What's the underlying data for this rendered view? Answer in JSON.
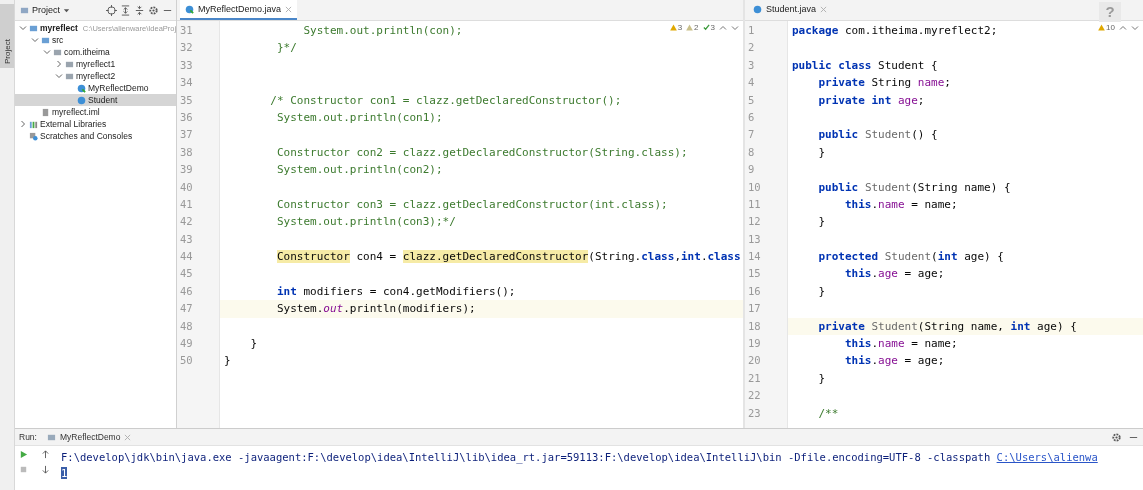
{
  "side_strip": {
    "label": "Project"
  },
  "project": {
    "title": "Project",
    "tree": [
      {
        "label": "myreflect",
        "path": "C:\\Users\\alienware\\IdeaProj",
        "kind": "module",
        "expanded": true,
        "selected": false,
        "children": [
          {
            "label": "src",
            "kind": "src",
            "expanded": true,
            "selected": false,
            "children": [
              {
                "label": "com.itheima",
                "kind": "package",
                "expanded": true,
                "selected": false,
                "children": [
                  {
                    "label": "myreflect1",
                    "kind": "package",
                    "expanded": false,
                    "selected": false
                  },
                  {
                    "label": "myreflect2",
                    "kind": "package",
                    "expanded": true,
                    "selected": false,
                    "children": [
                      {
                        "label": "MyReflectDemo",
                        "kind": "main-class",
                        "selected": false
                      },
                      {
                        "label": "Student",
                        "kind": "class",
                        "selected": true
                      }
                    ]
                  }
                ]
              }
            ]
          },
          {
            "label": "myreflect.iml",
            "kind": "iml",
            "selected": false
          }
        ]
      },
      {
        "label": "External Libraries",
        "kind": "libs",
        "expanded": false,
        "selected": false
      },
      {
        "label": "Scratches and Consoles",
        "kind": "scratch",
        "selected": false
      }
    ]
  },
  "editors": [
    {
      "tab": "MyReflectDemo.java",
      "kind": "main-class",
      "active": true,
      "inspections": [
        {
          "kind": "warning",
          "count": "3"
        },
        {
          "kind": "weak",
          "count": "2"
        },
        {
          "kind": "ok",
          "count": "3"
        }
      ],
      "lines": [
        {
          "num": "31",
          "current": false,
          "tokens": [
            {
              "kind": "comment",
              "text": "            System.out.println(con);"
            }
          ]
        },
        {
          "num": "32",
          "current": false,
          "tokens": [
            {
              "kind": "comment",
              "text": "        }*/"
            }
          ]
        },
        {
          "num": "33",
          "current": false
        },
        {
          "num": "34",
          "current": false
        },
        {
          "num": "35",
          "current": false,
          "tokens": [
            {
              "kind": "comment",
              "text": "       /* Constructor con1 = clazz.getDeclaredConstructor();"
            }
          ]
        },
        {
          "num": "36",
          "current": false,
          "tokens": [
            {
              "kind": "comment",
              "text": "        System.out.println(con1);"
            }
          ]
        },
        {
          "num": "37",
          "current": false
        },
        {
          "num": "38",
          "current": false,
          "tokens": [
            {
              "kind": "comment",
              "text": "        Constructor con2 = clazz.getDeclaredConstructor(String.class);"
            }
          ]
        },
        {
          "num": "39",
          "current": false,
          "tokens": [
            {
              "kind": "comment",
              "text": "        System.out.println(con2);"
            }
          ]
        },
        {
          "num": "40",
          "current": false
        },
        {
          "num": "41",
          "current": false,
          "tokens": [
            {
              "kind": "comment",
              "text": "        Constructor con3 = clazz.getDeclaredConstructor(int.class);"
            }
          ]
        },
        {
          "num": "42",
          "current": false,
          "tokens": [
            {
              "kind": "comment",
              "text": "        System.out.println(con3);*/"
            }
          ]
        },
        {
          "num": "43",
          "current": false
        },
        {
          "num": "44",
          "current": false,
          "tokens": [
            {
              "kind": "highlight",
              "text": "        Constructor"
            },
            {
              "kind": "plain",
              "text": " con4 = "
            },
            {
              "kind": "highlight",
              "text": "clazz.getDeclaredConstructor"
            },
            {
              "kind": "plain",
              "text": "(String."
            },
            {
              "kind": "keyword",
              "text": "class"
            },
            {
              "kind": "plain",
              "text": ","
            },
            {
              "kind": "keyword",
              "text": "int"
            },
            {
              "kind": "plain",
              "text": "."
            },
            {
              "kind": "keyword",
              "text": "class"
            }
          ]
        },
        {
          "num": "45",
          "current": false
        },
        {
          "num": "46",
          "current": false,
          "tokens": [
            {
              "kind": "keyword",
              "text": "        int"
            },
            {
              "kind": "plain",
              "text": " modifiers = con4.getModifiers();"
            }
          ]
        },
        {
          "num": "47",
          "current": true,
          "tokens": [
            {
              "kind": "plain",
              "text": "        System."
            },
            {
              "kind": "static",
              "text": "out"
            },
            {
              "kind": "plain",
              "text": ".println(modifiers);"
            }
          ]
        },
        {
          "num": "48",
          "current": false
        },
        {
          "num": "49",
          "current": false,
          "tokens": [
            {
              "kind": "plain",
              "text": "    }"
            }
          ]
        },
        {
          "num": "50",
          "current": false,
          "tokens": [
            {
              "kind": "plain",
              "text": "}"
            }
          ]
        }
      ]
    },
    {
      "tab": "Student.java",
      "kind": "class",
      "active": false,
      "inspections": [
        {
          "kind": "warning",
          "count": "10"
        }
      ],
      "lines": [
        {
          "num": "1",
          "current": false,
          "tokens": [
            {
              "kind": "keyword",
              "text": "package"
            },
            {
              "kind": "plain",
              "text": " com.itheima.myreflect2;"
            }
          ]
        },
        {
          "num": "2",
          "current": false
        },
        {
          "num": "3",
          "current": false,
          "tokens": [
            {
              "kind": "keyword",
              "text": "public class"
            },
            {
              "kind": "plain",
              "text": " Student {"
            }
          ]
        },
        {
          "num": "4",
          "current": false,
          "tokens": [
            {
              "kind": "keyword",
              "text": "    private"
            },
            {
              "kind": "plain",
              "text": " String "
            },
            {
              "kind": "field",
              "text": "name"
            },
            {
              "kind": "plain",
              "text": ";"
            }
          ]
        },
        {
          "num": "5",
          "current": false,
          "tokens": [
            {
              "kind": "keyword",
              "text": "    private int"
            },
            {
              "kind": "field",
              "text": " age"
            },
            {
              "kind": "plain",
              "text": ";"
            }
          ]
        },
        {
          "num": "6",
          "current": false
        },
        {
          "num": "7",
          "current": false,
          "tokens": [
            {
              "kind": "keyword",
              "text": "    public"
            },
            {
              "kind": "unused",
              "text": " Student"
            },
            {
              "kind": "plain",
              "text": "() {"
            }
          ]
        },
        {
          "num": "8",
          "current": false,
          "tokens": [
            {
              "kind": "plain",
              "text": "    }"
            }
          ]
        },
        {
          "num": "9",
          "current": false
        },
        {
          "num": "10",
          "current": false,
          "tokens": [
            {
              "kind": "keyword",
              "text": "    public"
            },
            {
              "kind": "unused",
              "text": " Student"
            },
            {
              "kind": "plain",
              "text": "(String name) {"
            }
          ]
        },
        {
          "num": "11",
          "current": false,
          "tokens": [
            {
              "kind": "keyword",
              "text": "        this"
            },
            {
              "kind": "plain",
              "text": "."
            },
            {
              "kind": "field",
              "text": "name"
            },
            {
              "kind": "plain",
              "text": " = name;"
            }
          ]
        },
        {
          "num": "12",
          "current": false,
          "tokens": [
            {
              "kind": "plain",
              "text": "    }"
            }
          ]
        },
        {
          "num": "13",
          "current": false
        },
        {
          "num": "14",
          "current": false,
          "tokens": [
            {
              "kind": "keyword",
              "text": "    protected"
            },
            {
              "kind": "unused",
              "text": " Student"
            },
            {
              "kind": "plain",
              "text": "("
            },
            {
              "kind": "keyword",
              "text": "int"
            },
            {
              "kind": "plain",
              "text": " age) {"
            }
          ]
        },
        {
          "num": "15",
          "current": false,
          "tokens": [
            {
              "kind": "keyword",
              "text": "        this"
            },
            {
              "kind": "plain",
              "text": "."
            },
            {
              "kind": "field",
              "text": "age"
            },
            {
              "kind": "plain",
              "text": " = age;"
            }
          ]
        },
        {
          "num": "16",
          "current": false,
          "tokens": [
            {
              "kind": "plain",
              "text": "    }"
            }
          ]
        },
        {
          "num": "17",
          "current": false
        },
        {
          "num": "18",
          "current": true,
          "tokens": [
            {
              "kind": "keyword",
              "text": "    private"
            },
            {
              "kind": "unused",
              "text": " Student"
            },
            {
              "kind": "plain",
              "text": "(String name, "
            },
            {
              "kind": "keyword",
              "text": "int"
            },
            {
              "kind": "plain",
              "text": " age) {"
            }
          ]
        },
        {
          "num": "19",
          "current": false,
          "tokens": [
            {
              "kind": "keyword",
              "text": "        this"
            },
            {
              "kind": "plain",
              "text": "."
            },
            {
              "kind": "field",
              "text": "name"
            },
            {
              "kind": "plain",
              "text": " = name;"
            }
          ]
        },
        {
          "num": "20",
          "current": false,
          "tokens": [
            {
              "kind": "keyword",
              "text": "        this"
            },
            {
              "kind": "plain",
              "text": "."
            },
            {
              "kind": "field",
              "text": "age"
            },
            {
              "kind": "plain",
              "text": " = age;"
            }
          ]
        },
        {
          "num": "21",
          "current": false,
          "tokens": [
            {
              "kind": "plain",
              "text": "    }"
            }
          ]
        },
        {
          "num": "22",
          "current": false
        },
        {
          "num": "23",
          "current": false,
          "tokens": [
            {
              "kind": "comment",
              "text": "    /**"
            }
          ]
        }
      ]
    }
  ],
  "help": {
    "label": "?"
  },
  "run": {
    "label": "Run:",
    "tab": "MyReflectDemo",
    "command": "F:\\develop\\jdk\\bin\\java.exe -javaagent:F:\\develop\\idea\\IntelliJ\\lib\\idea_rt.jar=59113:F:\\develop\\idea\\IntelliJ\\bin -Dfile.encoding=UTF-8 -classpath",
    "command_link": "C:\\Users\\alienwa",
    "output": [
      {
        "text": "1",
        "selected": true
      }
    ]
  }
}
